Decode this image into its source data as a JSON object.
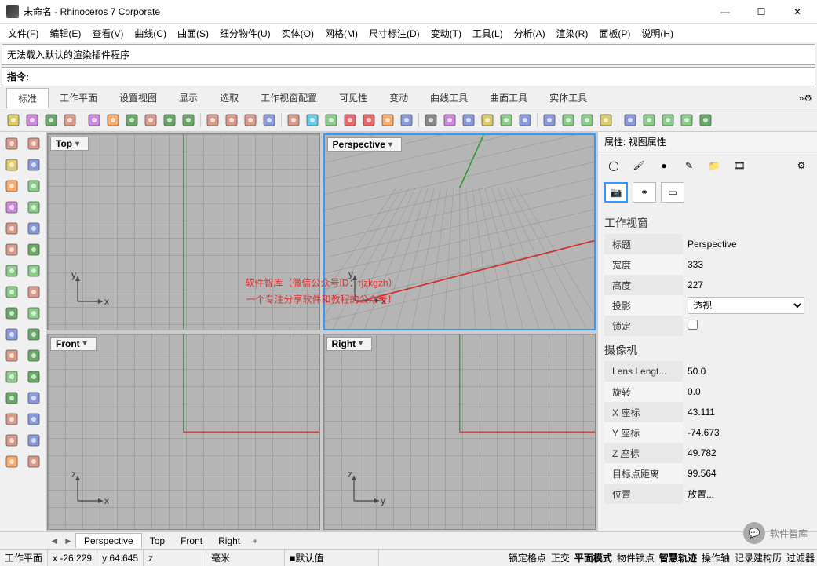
{
  "title": "未命名 - Rhinoceros 7 Corporate",
  "window_buttons": {
    "min": "—",
    "max": "☐",
    "close": "✕"
  },
  "menu": [
    "文件(F)",
    "编辑(E)",
    "查看(V)",
    "曲线(C)",
    "曲面(S)",
    "细分物件(U)",
    "实体(O)",
    "网格(M)",
    "尺寸标注(D)",
    "变动(T)",
    "工具(L)",
    "分析(A)",
    "渲染(R)",
    "面板(P)",
    "说明(H)"
  ],
  "message": "无法载入默认的渲染插件程序",
  "command_label": "指令:",
  "ribbon_tabs": [
    "标准",
    "工作平面",
    "设置视图",
    "显示",
    "选取",
    "工作视窗配置",
    "可见性",
    "变动",
    "曲线工具",
    "曲面工具",
    "实体工具"
  ],
  "ribbon_active": 0,
  "toolbar_icons": [
    "new-file-icon",
    "open-file-icon",
    "save-icon",
    "print-icon",
    "clipboard-icon",
    "cut-icon",
    "copy-icon",
    "paste-icon",
    "undo-icon",
    "redo-icon",
    "group-icon",
    "plane-icon",
    "point-icon",
    "layers-icon",
    "osnap-icon",
    "zoom-extents-icon",
    "zoom-in-icon",
    "zoom-window-icon",
    "rotate-view-icon",
    "pan-icon",
    "select-icon",
    "select-all-icon",
    "wireframe-icon",
    "shaded-icon",
    "rendered-icon",
    "ghosted-icon",
    "render-icon",
    "sphere-icon",
    "sphere2-icon",
    "sphere3-icon",
    "material-icon",
    "cplane-icon",
    "cplane2-icon",
    "cplane3-icon",
    "options-icon",
    "help-icon"
  ],
  "left_icons": [
    "arrow-icon",
    "lasso-icon",
    "polyline-icon",
    "circle-icon",
    "arc-icon",
    "ellipse-icon",
    "rectangle-icon",
    "polygon-icon",
    "curve-icon",
    "spiral-icon",
    "point-icon",
    "text-icon",
    "surface-icon",
    "extrude-icon",
    "revolve-icon",
    "sweep-icon",
    "loft-icon",
    "boolean-icon",
    "fillet-icon",
    "trim-icon",
    "split-icon",
    "join-icon",
    "explode-icon",
    "move-icon",
    "copy-icon",
    "rotate-icon",
    "scale-icon",
    "mirror-icon",
    "array-icon",
    "offset-icon",
    "dim-icon",
    "hatch-icon"
  ],
  "viewports": [
    {
      "name": "Top",
      "active": false,
      "axes": [
        "x",
        "y"
      ]
    },
    {
      "name": "Perspective",
      "active": true,
      "axes": [
        "x",
        "y"
      ]
    },
    {
      "name": "Front",
      "active": false,
      "axes": [
        "x",
        "z"
      ]
    },
    {
      "name": "Right",
      "active": false,
      "axes": [
        "y",
        "z"
      ]
    }
  ],
  "watermark": {
    "line1": "软件智库（微信公众号ID：rjzkgzh）",
    "line2": "一个专注分享软件和教程的公众号！"
  },
  "panel": {
    "title_prefix": "属性:",
    "title": "视图属性",
    "tab_icons": [
      "circle-icon",
      "brush-icon",
      "sphere-icon",
      "pencil-icon",
      "folder-icon",
      "film-icon",
      "gear-icon"
    ],
    "sub_icons": [
      "camera-icon",
      "link-icon",
      "frame-icon"
    ],
    "sections": [
      {
        "heading": "工作视窗",
        "rows": [
          {
            "label": "标题",
            "value": "Perspective",
            "type": "text"
          },
          {
            "label": "宽度",
            "value": "333",
            "type": "text"
          },
          {
            "label": "高度",
            "value": "227",
            "type": "text"
          },
          {
            "label": "投影",
            "value": "透视",
            "type": "select"
          },
          {
            "label": "锁定",
            "value": "",
            "type": "checkbox"
          }
        ]
      },
      {
        "heading": "摄像机",
        "rows": [
          {
            "label": "Lens Lengt...",
            "value": "50.0",
            "type": "text"
          },
          {
            "label": "旋转",
            "value": "0.0",
            "type": "text"
          },
          {
            "label": "X 座标",
            "value": "43.111",
            "type": "text"
          },
          {
            "label": "Y 座标",
            "value": "-74.673",
            "type": "text"
          },
          {
            "label": "Z 座标",
            "value": "49.782",
            "type": "text"
          },
          {
            "label": "目标点距离",
            "value": "99.564",
            "type": "text"
          },
          {
            "label": "位置",
            "value": "放置...",
            "type": "text"
          }
        ]
      }
    ]
  },
  "bottom_tabs": [
    "Perspective",
    "Top",
    "Front",
    "Right"
  ],
  "bottom_active": 0,
  "status": {
    "plane": "工作平面",
    "x_label": "x",
    "x": "-26.229",
    "y_label": "y",
    "y": "64.645",
    "z_label": "z",
    "z": "",
    "unit": "毫米",
    "default": "■默认值",
    "toggles": [
      "锁定格点",
      "正交",
      "平面模式",
      "物件锁点",
      "智慧轨迹",
      "操作轴",
      "记录建构历",
      "过滤器"
    ]
  },
  "corner_watermark": "软件智库"
}
